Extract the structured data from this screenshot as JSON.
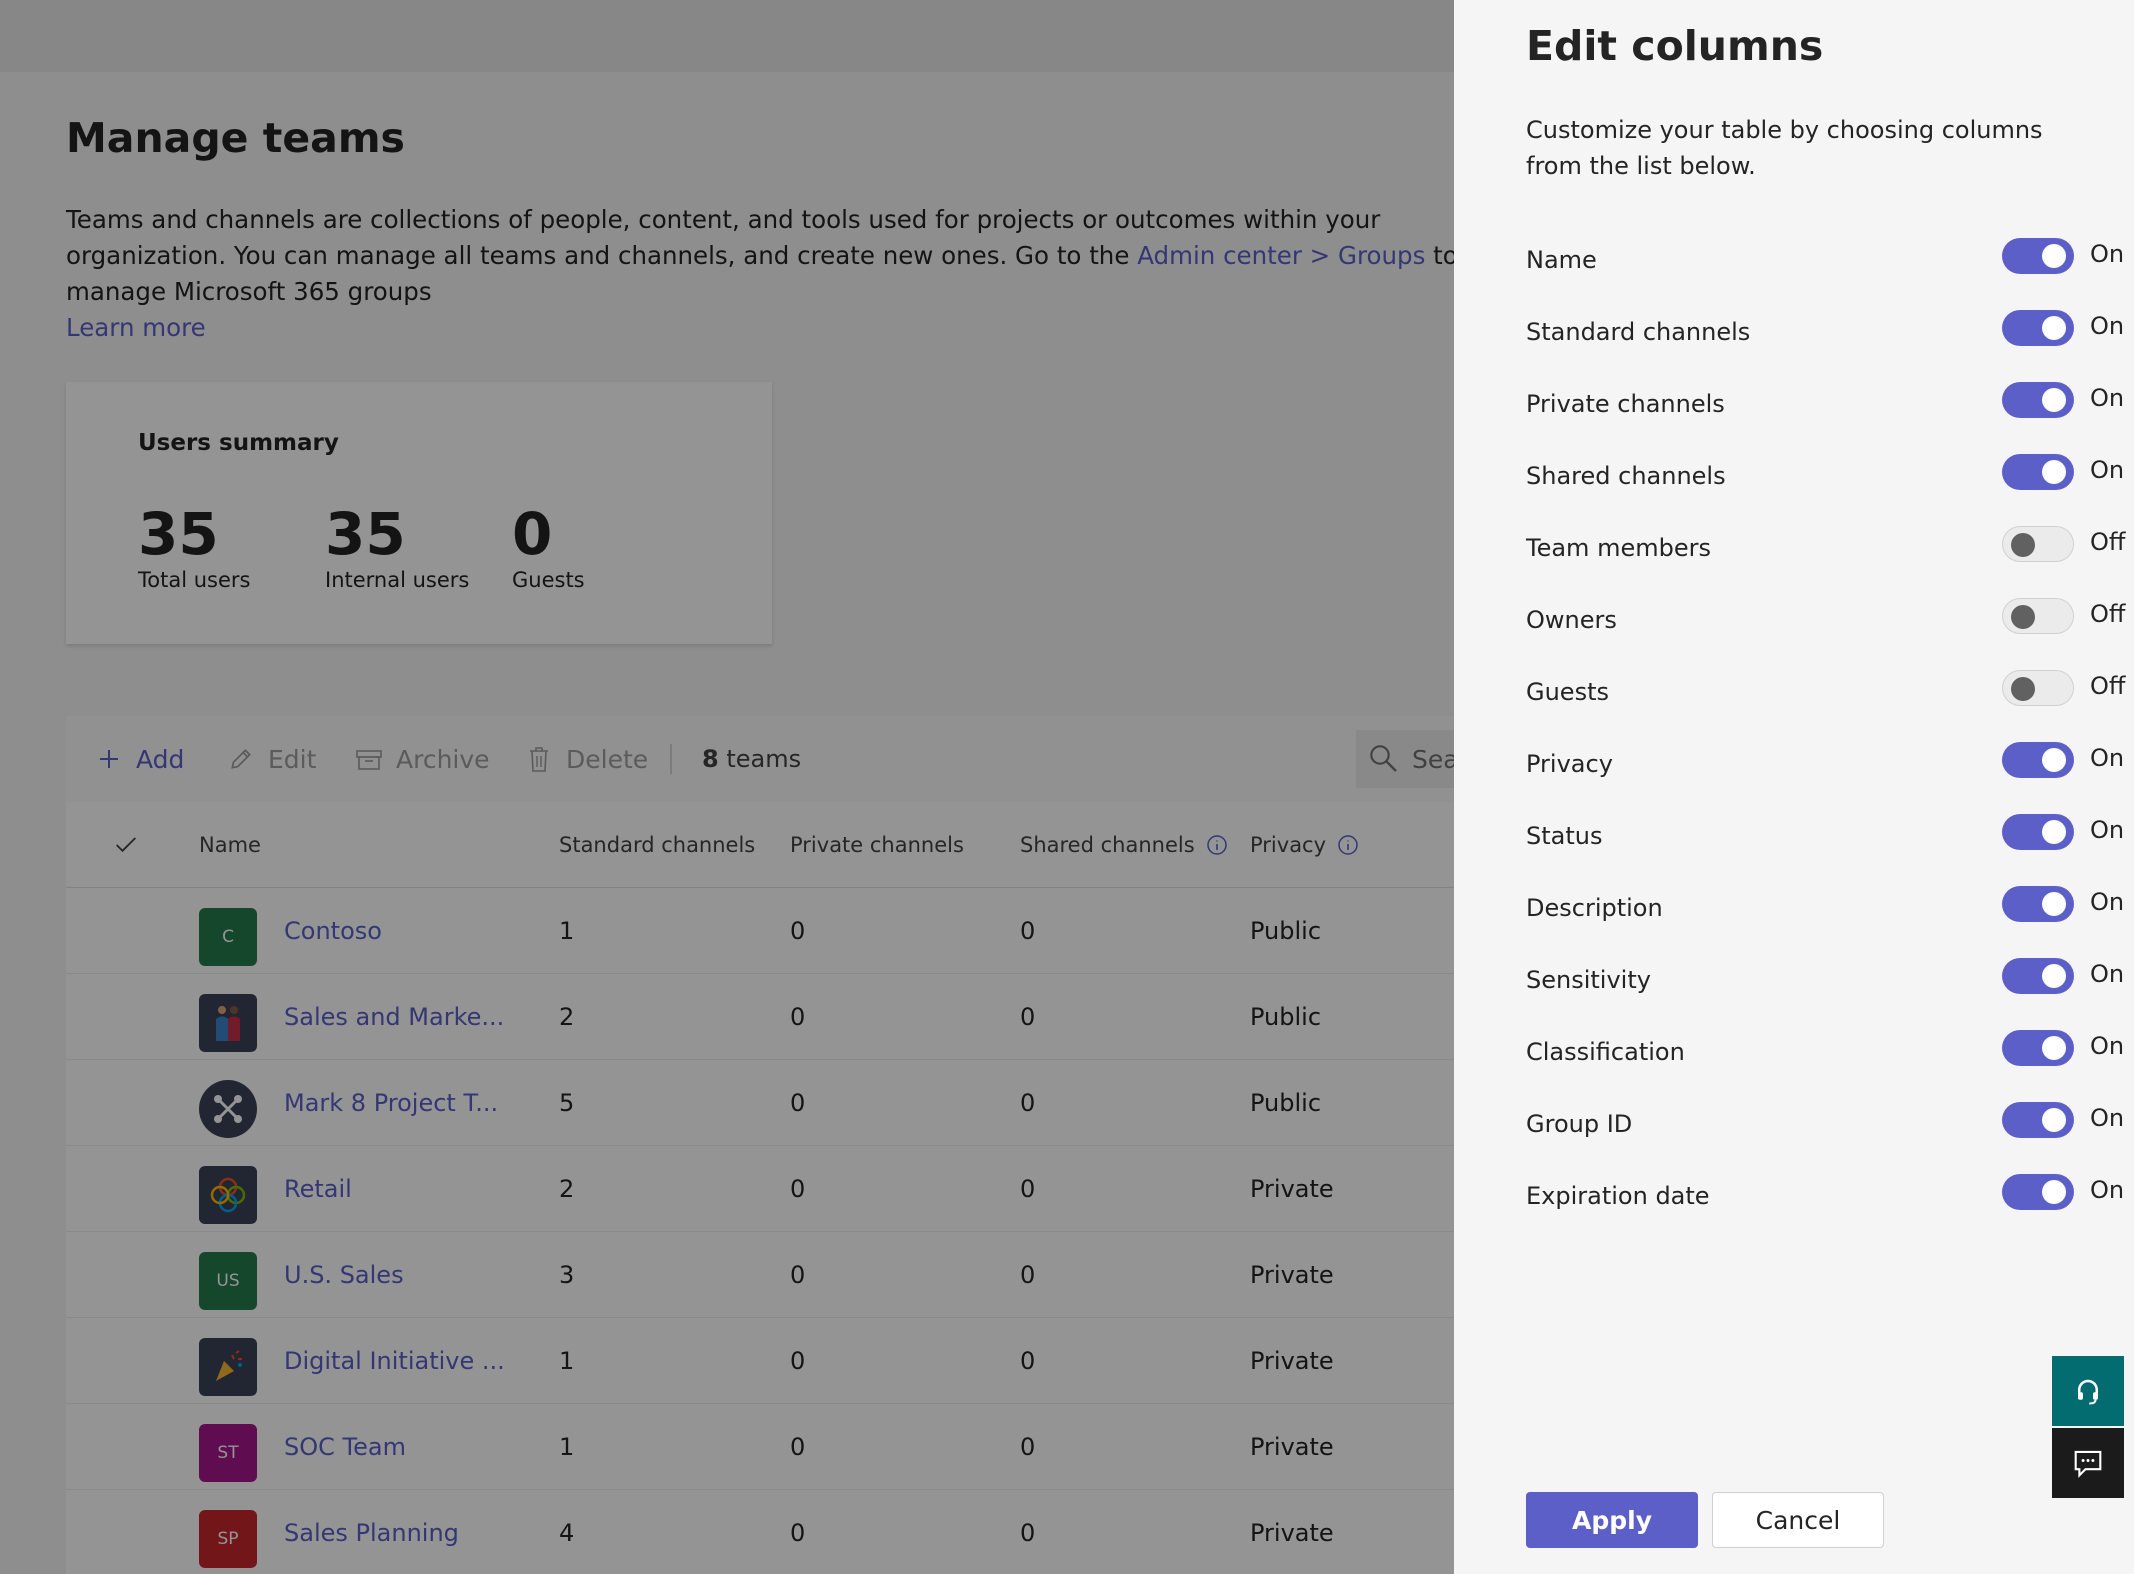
{
  "page": {
    "title": "Manage teams",
    "description_pre": "Teams and channels are collections of people, content, and tools used for projects or outcomes within your organization. You can manage all teams and channels, and create new ones. Go to the ",
    "description_link": "Admin center > Groups",
    "description_post": " to manage Microsoft 365 groups",
    "learn_more": "Learn more"
  },
  "summary": {
    "title": "Users summary",
    "total_value": "35",
    "total_label": "Total users",
    "internal_value": "35",
    "internal_label": "Internal users",
    "guests_value": "0",
    "guests_label": "Guests"
  },
  "toolbar": {
    "add": "Add",
    "edit": "Edit",
    "archive": "Archive",
    "delete": "Delete",
    "count_num": "8",
    "count_word": "teams",
    "search_placeholder": "Sea"
  },
  "table": {
    "headers": [
      "Name",
      "Standard channels",
      "Private channels",
      "Shared channels",
      "Privacy"
    ],
    "rows": [
      {
        "initials": "C",
        "color": "#237b4b",
        "name": "Contoso",
        "std": "1",
        "priv": "0",
        "shared": "0",
        "privacy": "Public"
      },
      {
        "initials": "",
        "color": "#3a4357",
        "name": "Sales and Marke...",
        "std": "2",
        "priv": "0",
        "shared": "0",
        "privacy": "Public"
      },
      {
        "initials": "",
        "color": "#3a4357",
        "name": "Mark 8 Project T...",
        "std": "5",
        "priv": "0",
        "shared": "0",
        "privacy": "Public"
      },
      {
        "initials": "",
        "color": "#3a4357",
        "name": "Retail",
        "std": "2",
        "priv": "0",
        "shared": "0",
        "privacy": "Private"
      },
      {
        "initials": "US",
        "color": "#237b4b",
        "name": "U.S. Sales",
        "std": "3",
        "priv": "0",
        "shared": "0",
        "privacy": "Private"
      },
      {
        "initials": "",
        "color": "#3a4357",
        "name": "Digital Initiative ...",
        "std": "1",
        "priv": "0",
        "shared": "0",
        "privacy": "Private"
      },
      {
        "initials": "ST",
        "color": "#a4158c",
        "name": "SOC Team",
        "std": "1",
        "priv": "0",
        "shared": "0",
        "privacy": "Private"
      },
      {
        "initials": "SP",
        "color": "#c4262e",
        "name": "Sales Planning",
        "std": "4",
        "priv": "0",
        "shared": "0",
        "privacy": "Private"
      }
    ]
  },
  "panel": {
    "title": "Edit columns",
    "description": "Customize your table by choosing columns from the list below.",
    "columns": [
      {
        "label": "Name",
        "on": true,
        "state": "On"
      },
      {
        "label": "Standard channels",
        "on": true,
        "state": "On"
      },
      {
        "label": "Private channels",
        "on": true,
        "state": "On"
      },
      {
        "label": "Shared channels",
        "on": true,
        "state": "On"
      },
      {
        "label": "Team members",
        "on": false,
        "state": "Off"
      },
      {
        "label": "Owners",
        "on": false,
        "state": "Off"
      },
      {
        "label": "Guests",
        "on": false,
        "state": "Off"
      },
      {
        "label": "Privacy",
        "on": true,
        "state": "On"
      },
      {
        "label": "Status",
        "on": true,
        "state": "On"
      },
      {
        "label": "Description",
        "on": true,
        "state": "On"
      },
      {
        "label": "Sensitivity",
        "on": true,
        "state": "On"
      },
      {
        "label": "Classification",
        "on": true,
        "state": "On"
      },
      {
        "label": "Group ID",
        "on": true,
        "state": "On"
      },
      {
        "label": "Expiration date",
        "on": true,
        "state": "On"
      }
    ],
    "apply": "Apply",
    "cancel": "Cancel"
  },
  "icons": {
    "help": "headset-icon",
    "feedback": "feedback-icon"
  },
  "colors": {
    "accent": "#5b5fc7",
    "help_fab": "#036c70",
    "feedback_fab": "#1b1b1b"
  }
}
